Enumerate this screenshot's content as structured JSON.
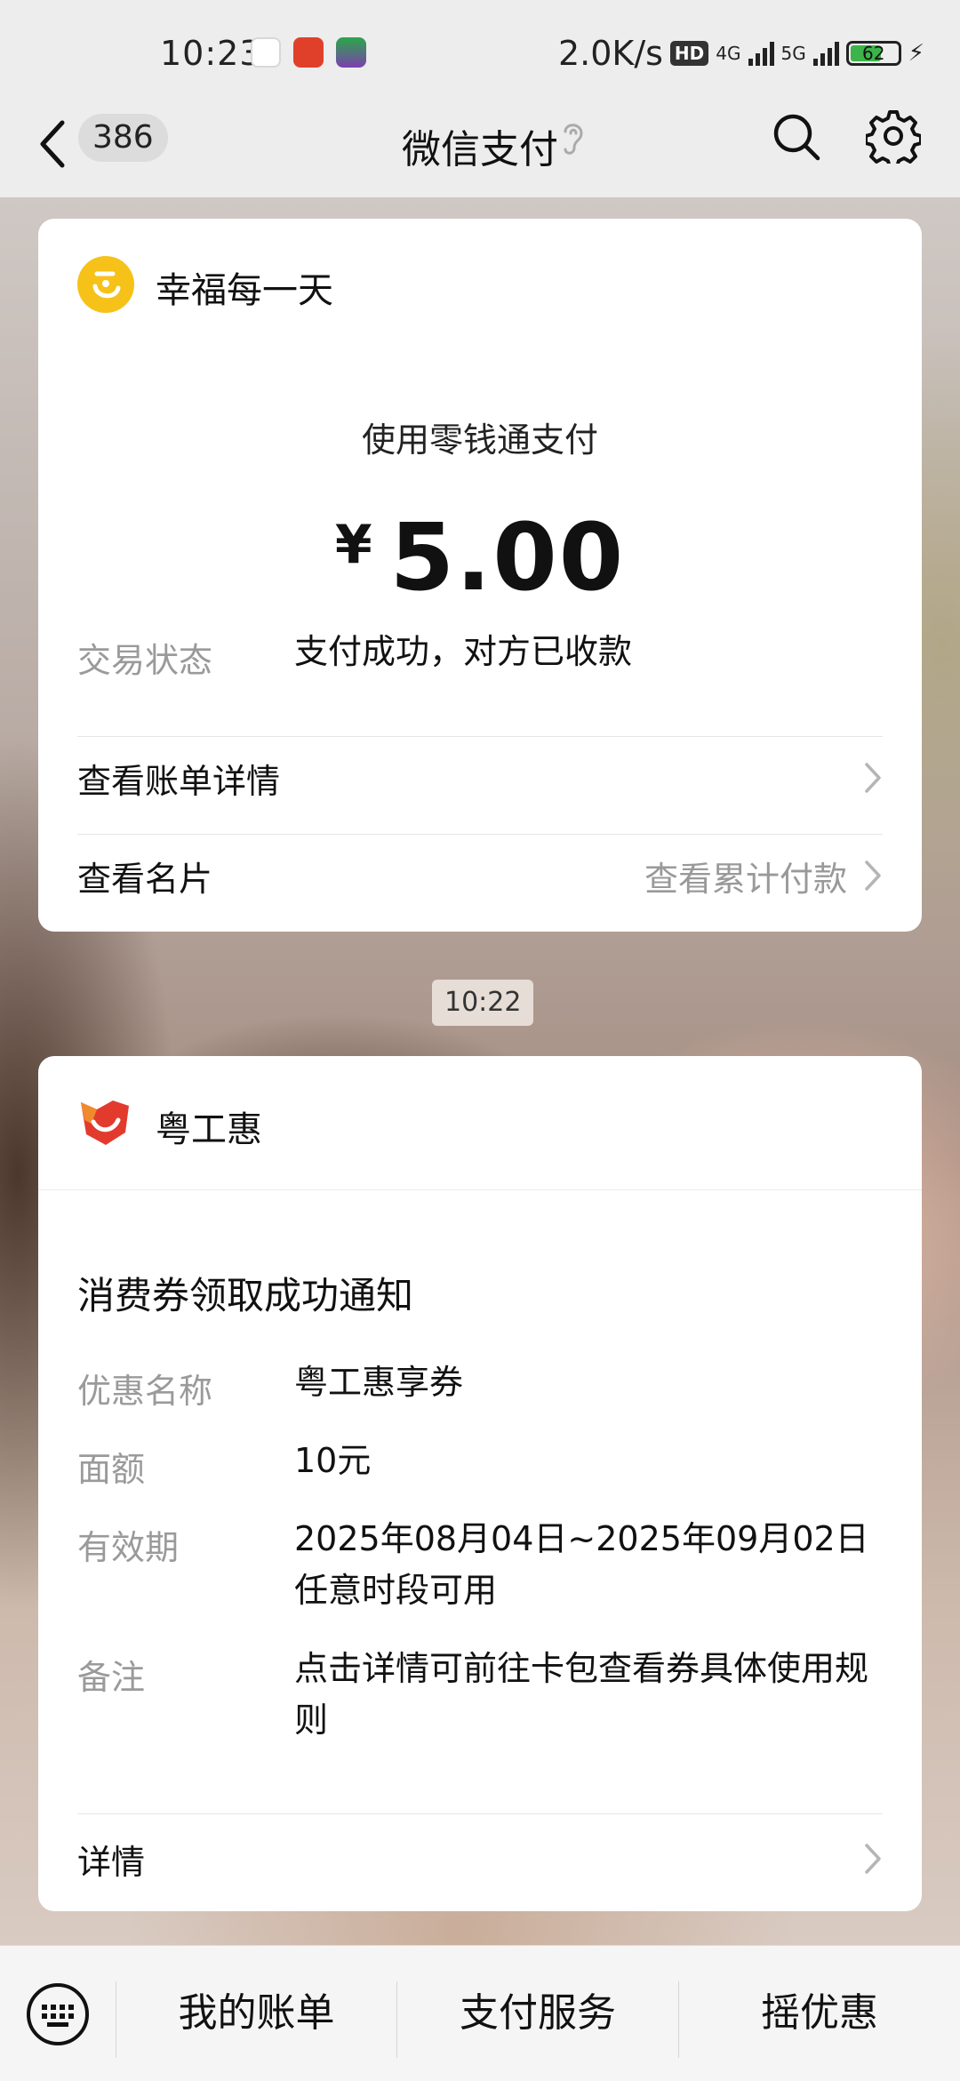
{
  "status_bar": {
    "time": "10:23",
    "net_speed": "2.0K/s",
    "hd_label": "HD",
    "signal_1": "4G",
    "signal_2": "5G",
    "battery": "62"
  },
  "nav": {
    "unread_count": "386",
    "title": "微信支付"
  },
  "payment_card": {
    "merchant_name": "幸福每一天",
    "pay_method": "使用零钱通支付",
    "currency_symbol": "¥",
    "amount": "5.00",
    "status_label": "交易状态",
    "status_value": "支付成功，对方已收款",
    "link_bill": "查看账单详情",
    "link_card": "查看名片",
    "link_card_sub": "查看累计付款"
  },
  "timestamp": "10:22",
  "coupon_card": {
    "merchant_name": "粤工惠",
    "title": "消费券领取成功通知",
    "rows": [
      {
        "label": "优惠名称",
        "value": "粤工惠享券"
      },
      {
        "label": "面额",
        "value": "10元"
      },
      {
        "label": "有效期",
        "value": "2025年08月04日~2025年09月02日任意时段可用"
      },
      {
        "label": "备注",
        "value": "点击详情可前往卡包查看券具体使用规则"
      }
    ],
    "link_details": "详情"
  },
  "bottom_menu": {
    "items": [
      "我的账单",
      "支付服务",
      "摇优惠"
    ]
  },
  "colors": {
    "accent_yellow": "#f6c21a",
    "brand_red": "#e23b2e",
    "battery_green": "#3cb44a"
  }
}
